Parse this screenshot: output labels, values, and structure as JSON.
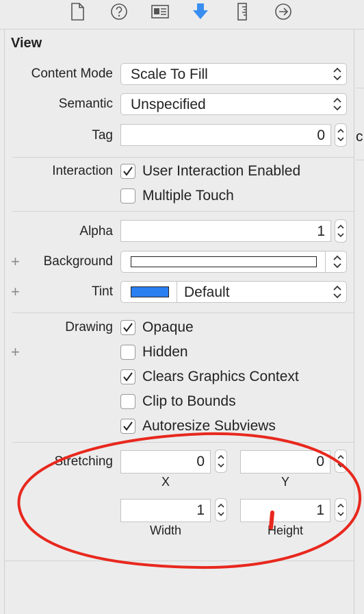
{
  "toolbar": {
    "icons": [
      "file-icon",
      "help-icon",
      "identity-icon",
      "attributes-icon",
      "size-icon",
      "connections-icon"
    ],
    "accent": "#3a8ef0"
  },
  "section": {
    "title": "View"
  },
  "content_mode": {
    "label": "Content Mode",
    "value": "Scale To Fill"
  },
  "semantic": {
    "label": "Semantic",
    "value": "Unspecified"
  },
  "tag": {
    "label": "Tag",
    "value": "0"
  },
  "interaction": {
    "label": "Interaction",
    "user_interaction": {
      "label": "User Interaction Enabled",
      "checked": true
    },
    "multiple_touch": {
      "label": "Multiple Touch",
      "checked": false
    }
  },
  "alpha": {
    "label": "Alpha",
    "value": "1"
  },
  "background": {
    "label": "Background",
    "color": "#ffffff"
  },
  "tint": {
    "label": "Tint",
    "value": "Default",
    "color": "#2b7ff0"
  },
  "drawing": {
    "label": "Drawing",
    "opaque": {
      "label": "Opaque",
      "checked": true
    },
    "hidden": {
      "label": "Hidden",
      "checked": false
    },
    "clears_graphics": {
      "label": "Clears Graphics Context",
      "checked": true
    },
    "clip_to_bounds": {
      "label": "Clip to Bounds",
      "checked": false
    },
    "autoresize": {
      "label": "Autoresize Subviews",
      "checked": true
    }
  },
  "stretching": {
    "label": "Stretching",
    "x": {
      "value": "0",
      "caption": "X"
    },
    "y": {
      "value": "0",
      "caption": "Y"
    },
    "width": {
      "value": "1",
      "caption": "Width"
    },
    "height": {
      "value": "1",
      "caption": "Height"
    }
  },
  "overflow_glyph": "c",
  "annotation": {
    "color": "#e8281e"
  }
}
